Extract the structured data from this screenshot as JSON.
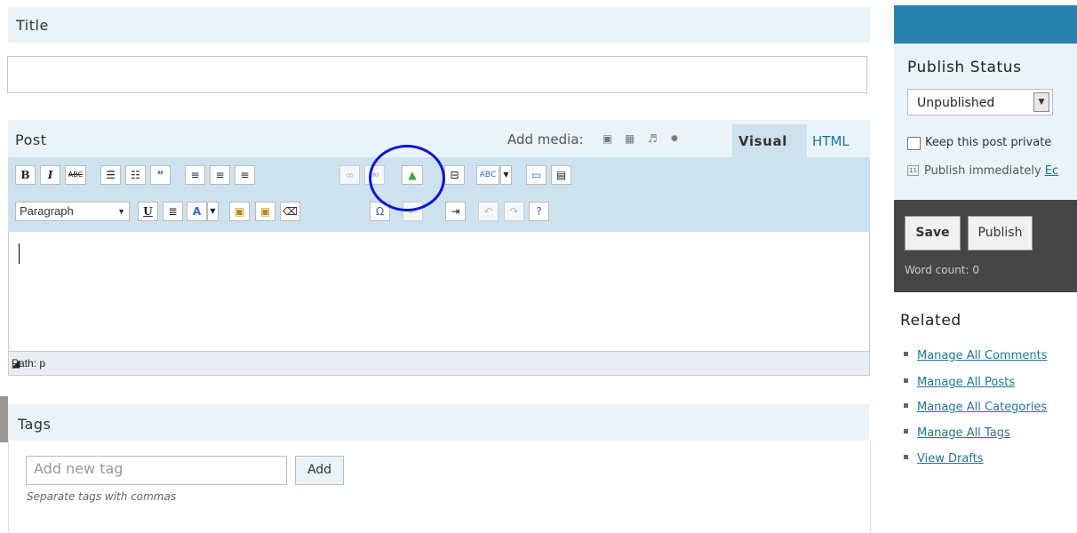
{
  "title_section": {
    "label": "Title",
    "input_value": ""
  },
  "post": {
    "label": "Post",
    "add_media_label": "Add media:",
    "tabs": {
      "visual": "Visual",
      "html": "HTML"
    },
    "format_select": "Paragraph",
    "path": "Path: p",
    "body": ""
  },
  "toolbar_row1": [
    "bold-button",
    "italic-button",
    "strikethrough-button",
    "bullet-list-button",
    "numbered-list-button",
    "blockquote-button",
    "align-left-button",
    "align-center-button",
    "align-right-button",
    "link-button",
    "unlink-button",
    "insert-image-button",
    "more-tag-button",
    "spellcheck-button",
    "spellcheck-dropdown",
    "fullscreen-button",
    "kitchen-sink-button"
  ],
  "toolbar_row2": [
    "underline-button",
    "justify-button",
    "text-color-button",
    "text-color-dropdown",
    "paste-text-button",
    "paste-word-button",
    "remove-format-button",
    "special-char-button",
    "outdent-button",
    "indent-button",
    "undo-button",
    "redo-button",
    "help-button"
  ],
  "tags": {
    "label": "Tags",
    "input_placeholder": "Add new tag",
    "add_button": "Add",
    "hint": "Separate tags with commas"
  },
  "sidebar": {
    "publish_status_label": "Publish Status",
    "status_value": "Unpublished",
    "private_label": "Keep this post private",
    "publish_immediately": "Publish immediately",
    "edit_link": "Ec",
    "save_button": "Save",
    "publish_button": "Publish",
    "word_count": "Word count: 0",
    "related_label": "Related",
    "related_links": [
      "Manage All Comments",
      "Manage All Posts",
      "Manage All Categories",
      "Manage All Tags",
      "View Drafts"
    ]
  },
  "colors": {
    "accent": "#21759b",
    "header_bg": "#eaf2fa",
    "toolbar_bg": "#cee1ef",
    "dark_box": "#464646",
    "annotation_circle": "#1014d4"
  }
}
